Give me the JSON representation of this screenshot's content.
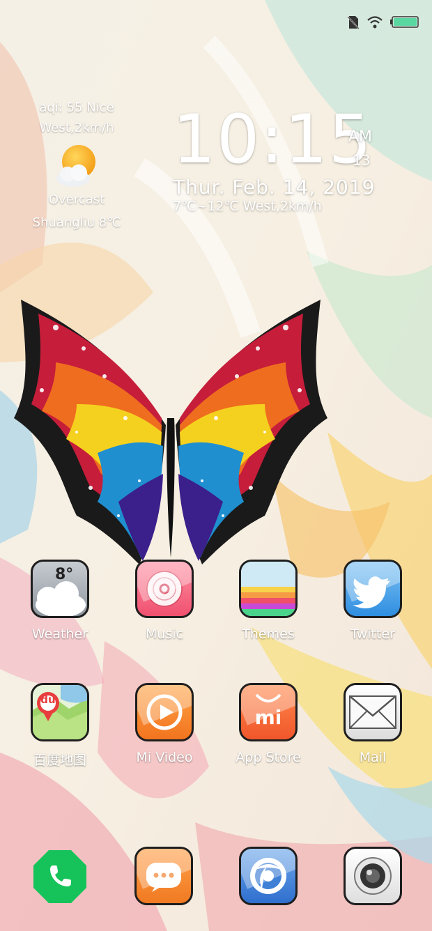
{
  "status_bar": {
    "icons": [
      "no-sim-icon",
      "wifi-icon",
      "battery-icon"
    ],
    "battery_color": "#58d7a0"
  },
  "weather": {
    "aqi": "aqi: 55 Nice",
    "wind": "West,2km/h",
    "icon": "partly-cloudy-icon",
    "condition": "Overcast",
    "location": "Shuangliu 8℃"
  },
  "clock": {
    "time": "10:15",
    "ampm": "AM",
    "seconds": "13",
    "date": "Thur.  Feb. 14,  2019",
    "temp_line": "7℃~12℃  West,2km/h"
  },
  "apps_row1": [
    {
      "label": "Weather",
      "icon": "weather-icon",
      "badge": "8°"
    },
    {
      "label": "Music",
      "icon": "music-icon"
    },
    {
      "label": "Themes",
      "icon": "themes-icon"
    },
    {
      "label": "Twitter",
      "icon": "twitter-icon"
    }
  ],
  "apps_row2": [
    {
      "label": "百度地图",
      "icon": "baidu-map-icon",
      "badge": "du"
    },
    {
      "label": "Mi Video",
      "icon": "video-icon"
    },
    {
      "label": "App Store",
      "icon": "app-store-icon",
      "badge": "mi"
    },
    {
      "label": "Mail",
      "icon": "mail-icon"
    }
  ],
  "dock": [
    {
      "icon": "phone-icon",
      "color": "#16c35a"
    },
    {
      "icon": "messages-icon",
      "color": "#f4842a"
    },
    {
      "icon": "browser-icon",
      "color": "#3f7fd6"
    },
    {
      "icon": "camera-icon",
      "color": "#f2f2f2"
    }
  ]
}
